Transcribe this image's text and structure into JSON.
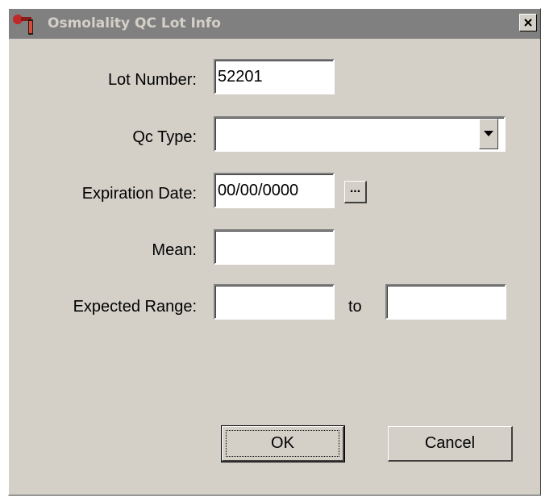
{
  "window": {
    "title": "Osmolality QC Lot Info",
    "icon": "app-icon",
    "close_icon": "close-icon"
  },
  "form": {
    "lot_number": {
      "label": "Lot Number:",
      "value": "52201"
    },
    "qc_type": {
      "label": "Qc Type:",
      "value": ""
    },
    "expiration_date": {
      "label": "Expiration Date:",
      "value": "00/00/0000",
      "picker_label": "..."
    },
    "mean": {
      "label": "Mean:",
      "value": ""
    },
    "expected_range": {
      "label": "Expected Range:",
      "from_value": "",
      "separator": "to",
      "to_value": ""
    }
  },
  "buttons": {
    "ok": "OK",
    "cancel": "Cancel"
  }
}
